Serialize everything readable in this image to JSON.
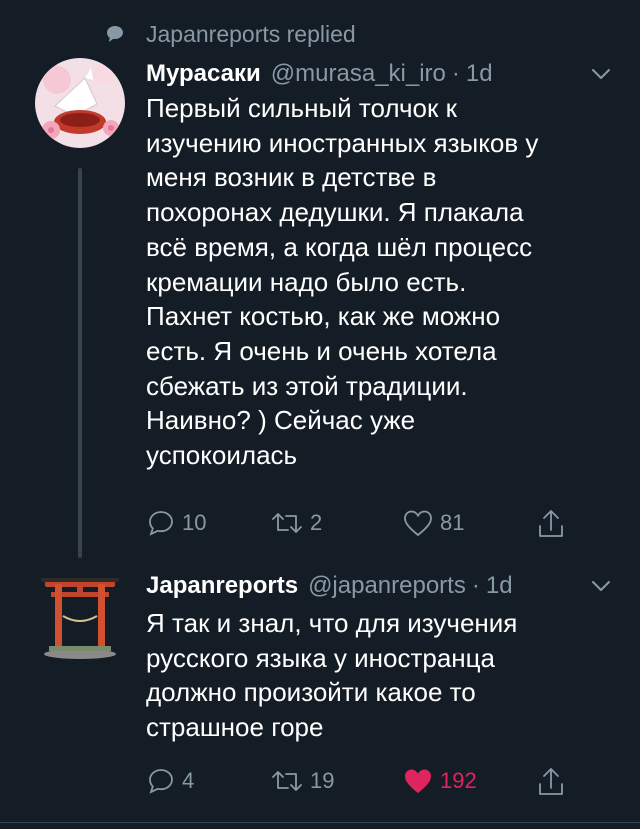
{
  "context": {
    "label": "Japanreports replied"
  },
  "tweets": [
    {
      "name": "Мурасаки",
      "handle": "@murasa_ki_iro",
      "time": "1d",
      "lines": [
        "Первый сильный толчок к",
        "изучению иностранных языков у",
        "меня возник в детстве в",
        "похоронах дедушки. Я плакала",
        "всё время, а когда шёл процесс",
        "кремации надо было есть.",
        "Пахнет костью, как же можно",
        "есть. Я очень и очень хотела",
        "сбежать из этой традиции.",
        "Наивно? ) Сейчас уже",
        "успокоилась"
      ],
      "replies": "10",
      "retweets": "2",
      "likes": "81",
      "liked": false
    },
    {
      "name": "Japanreports",
      "handle": "@japanreports",
      "time": "1d",
      "lines": [
        "Я так и знал, что для изучения",
        "русского языка у иностранца",
        "должно произойти какое то",
        "страшное горе"
      ],
      "replies": "4",
      "retweets": "19",
      "likes": "192",
      "liked": true
    }
  ],
  "icons": {
    "reply": "reply-icon",
    "retweet": "retweet-icon",
    "like": "heart-icon",
    "share": "share-icon",
    "menu": "chevron-down-icon",
    "context": "speech-bubble-icon"
  },
  "colors": {
    "background": "#141d26",
    "secondary_text": "#8899a6",
    "like_active": "#e0245e",
    "thread_line": "#38444d"
  }
}
